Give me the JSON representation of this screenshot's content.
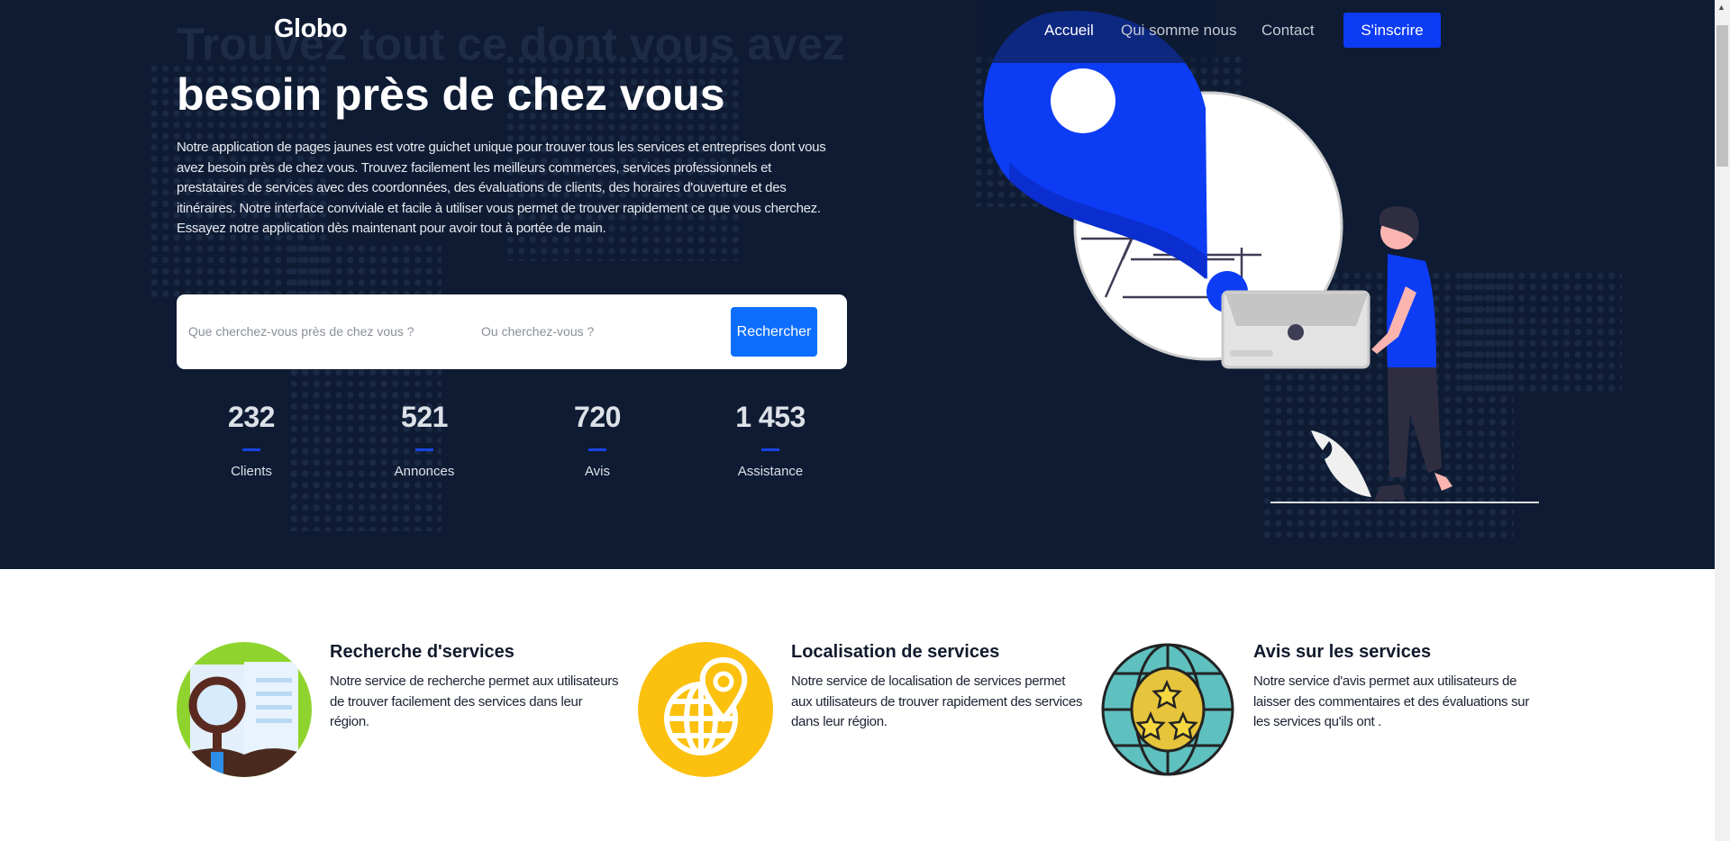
{
  "header": {
    "logo": "Globo",
    "nav": [
      {
        "label": "Accueil",
        "active": true
      },
      {
        "label": "Qui somme nous"
      },
      {
        "label": "Contact"
      }
    ],
    "signup_label": "S'inscrire"
  },
  "hero": {
    "title_line1": "Trouvez tout ce dont vous avez",
    "title_line2": "besoin près de chez vous",
    "description": "Notre application de pages jaunes est votre guichet unique pour trouver tous les services et entreprises dont vous avez besoin près de chez vous. Trouvez facilement les meilleurs commerces, services professionnels et prestataires de services avec des coordonnées, des évaluations de clients, des horaires d'ouverture et des itinéraires. Notre interface conviviale et facile à utiliser vous permet de trouver rapidement ce que vous cherchez. Essayez notre application dès maintenant pour avoir tout à portée de main.",
    "search": {
      "what_placeholder": "Que cherchez-vous près de chez vous ?",
      "what_value": "",
      "where_placeholder": "Ou cherchez-vous ?",
      "where_value": "",
      "button_label": "Rechercher"
    },
    "stats": [
      {
        "value": "232",
        "label": "Clients"
      },
      {
        "value": "521",
        "label": "Annonces"
      },
      {
        "value": "720",
        "label": "Avis"
      },
      {
        "value": "1 453",
        "label": "Assistance"
      }
    ]
  },
  "features": [
    {
      "title": "Recherche d'services",
      "description": "Notre service de recherche permet aux utilisateurs de trouver facilement des services dans leur région.",
      "icon": "magnifier-book-icon"
    },
    {
      "title": "Localisation de services",
      "description": "Notre service de localisation de services permet aux utilisateurs de trouver rapidement des services dans leur région.",
      "icon": "globe-pin-icon"
    },
    {
      "title": "Avis sur les services",
      "description": "Notre service d'avis permet aux utilisateurs de laisser des commentaires et des évaluations sur les services qu'ils ont .",
      "icon": "globe-stars-icon"
    }
  ],
  "colors": {
    "hero_bg": "#0e1b33",
    "accent": "#0d3cf5",
    "button": "#0d6efd"
  }
}
